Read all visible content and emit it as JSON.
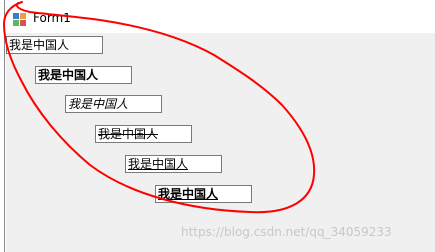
{
  "window": {
    "title": "Form1",
    "icon": "winforms-form-icon"
  },
  "textboxes": [
    {
      "text": "我是中国人",
      "style": "regular"
    },
    {
      "text": "我是中国人",
      "style": "bold"
    },
    {
      "text": "我是中国人",
      "style": "italic"
    },
    {
      "text": "我是中国人",
      "style": "strikeout"
    },
    {
      "text": "我是中国人",
      "style": "underline"
    },
    {
      "text": "我是中国人",
      "style": "bold-underline"
    }
  ],
  "annotation": {
    "shape": "freehand-ellipse",
    "color": "#ff0000"
  },
  "watermark": "https://blog.csdn.net/qq_34059233"
}
